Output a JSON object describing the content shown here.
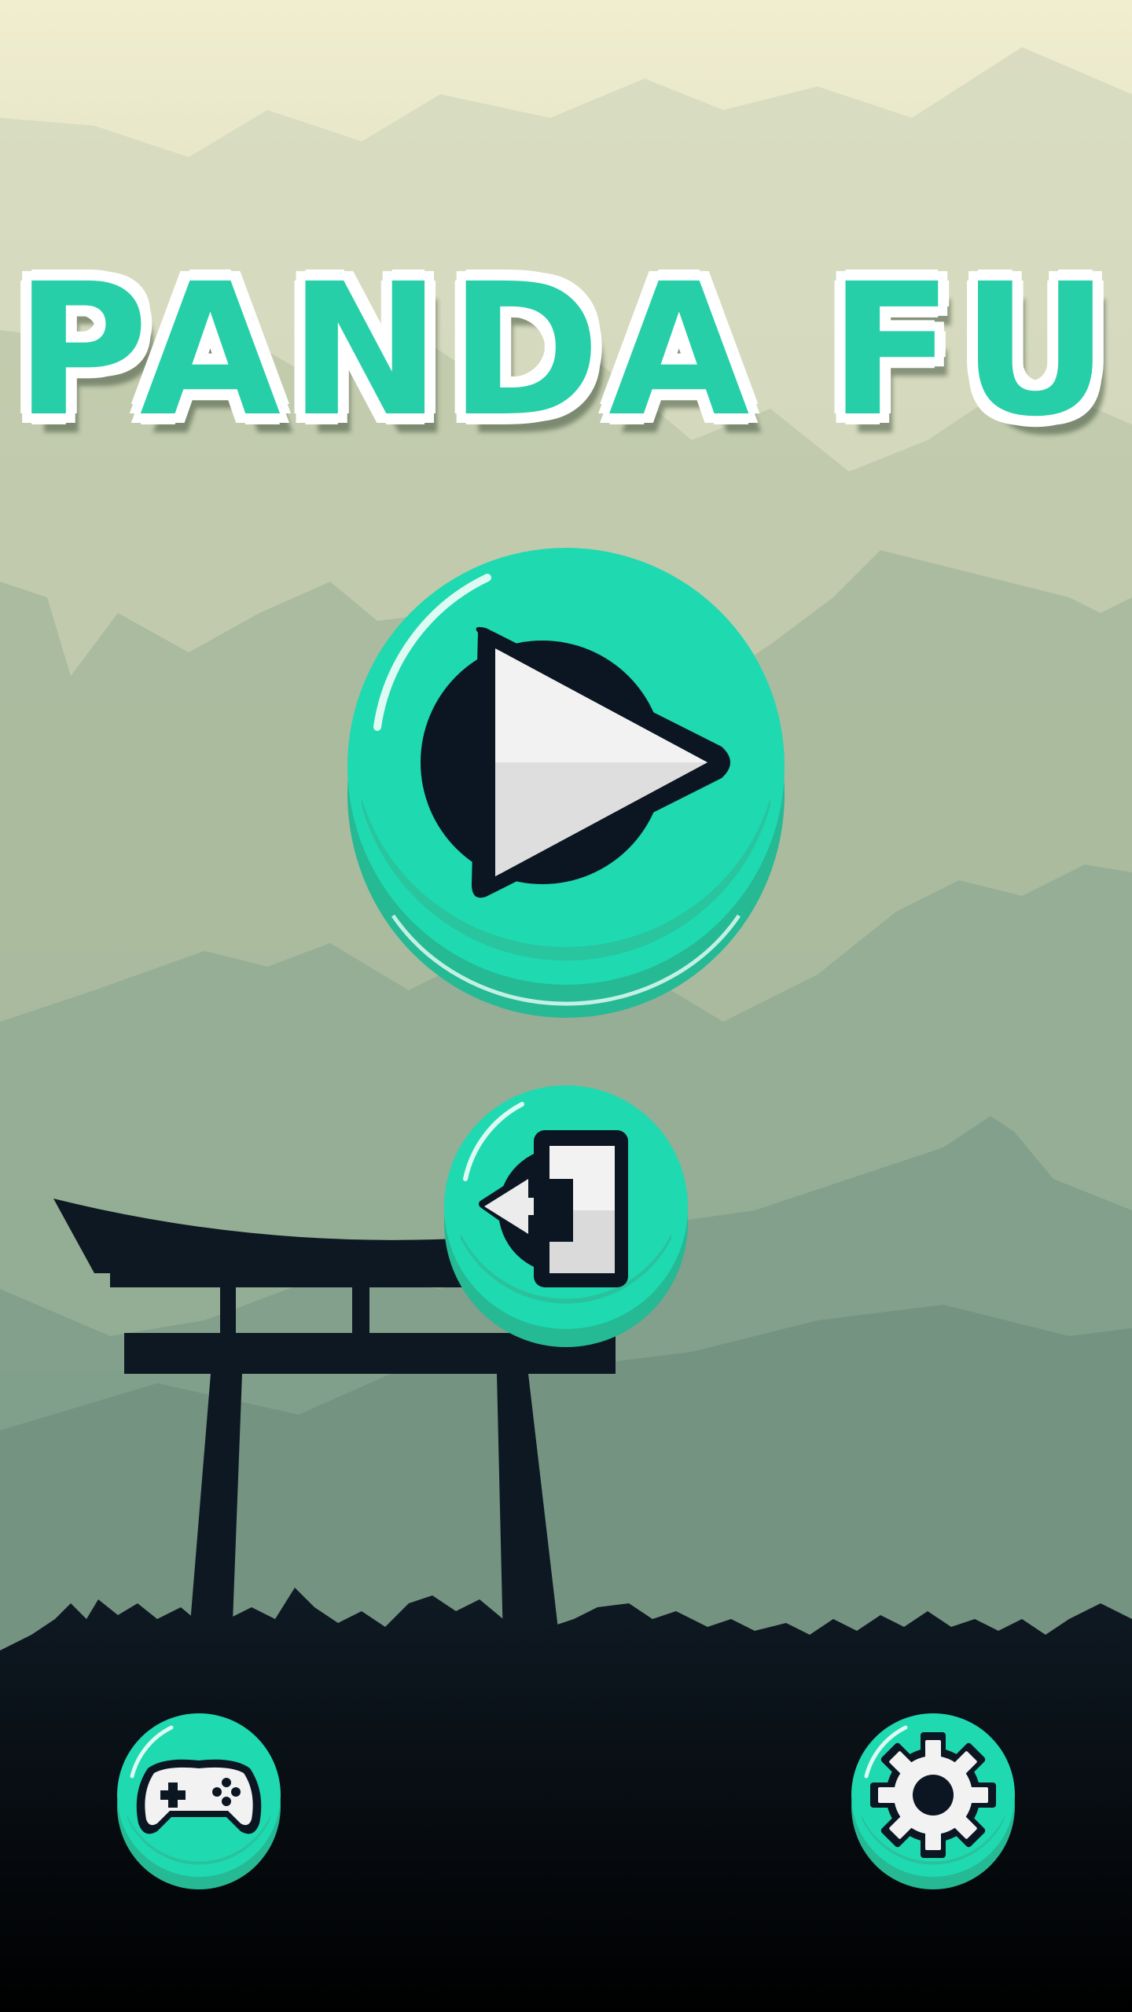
{
  "game": {
    "title": "PANDA FU"
  },
  "buttons": {
    "play": {
      "icon": "play-icon"
    },
    "exit": {
      "icon": "exit-door-icon"
    },
    "gamepad": {
      "icon": "gamepad-icon"
    },
    "settings": {
      "icon": "gear-icon"
    }
  },
  "colors": {
    "button_face": "#1fd9b0",
    "button_rim": "#29c29d",
    "icon_dark": "#0b1622",
    "icon_light": "#ececec",
    "sky_top": "#f3f0d0",
    "ground": "#0b0f14",
    "silhouette": "#0f1a24"
  }
}
